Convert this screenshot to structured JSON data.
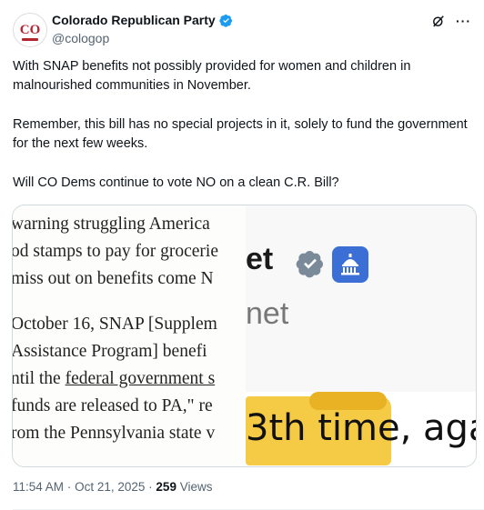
{
  "author": {
    "display_name": "Colorado Republican Party",
    "handle": "@cologop",
    "avatar_text": "CO",
    "verified_color": "#1d9bf0"
  },
  "tweet": {
    "paragraphs": [
      "With SNAP benefits not possibly provided for women and children in malnourished communities in November.",
      "Remember, this bill has no special projects in it, solely to fund the government for the next few weeks.",
      "Will CO Dems continue to vote NO on a clean C.R. Bill?"
    ]
  },
  "media": {
    "left_lines": [
      " warning struggling America",
      "od stamps to pay for grocerie",
      "miss out on benefits come N",
      "",
      "October 16, SNAP  [Supplem",
      "Assistance Program] benefi",
      "ntil the ",
      "funds are released to PA,\" re",
      "rom the Pennsylvania state v"
    ],
    "underlined_text": "federal government s",
    "right_top_text": "et",
    "right_mid_text": "net",
    "right_bottom_text": "3th time, aga",
    "highlight_color": "#f4c430"
  },
  "meta": {
    "time": "11:54 AM",
    "separator": "·",
    "date": "Oct 21, 2025",
    "views_count": "259",
    "views_label": "Views"
  },
  "icons": {
    "grok": "grok-icon",
    "more": "more-icon"
  }
}
